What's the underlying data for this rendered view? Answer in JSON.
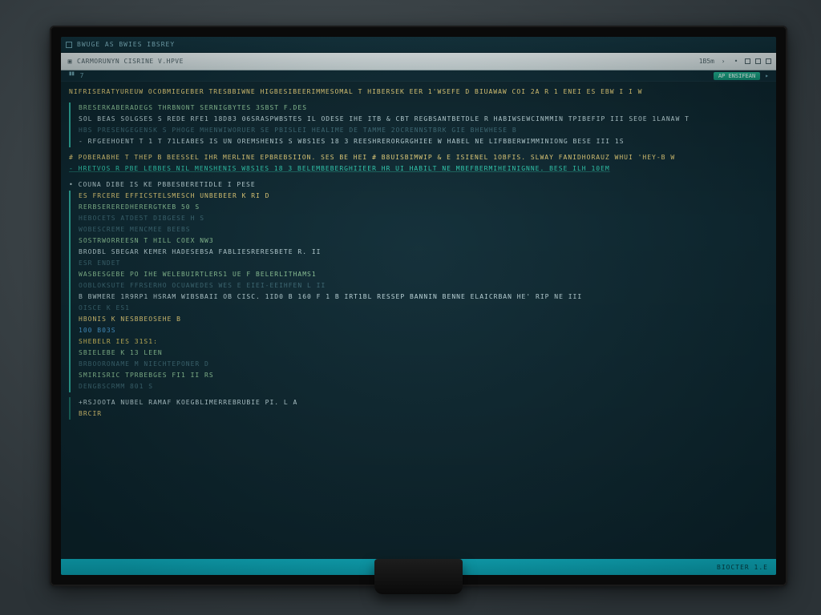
{
  "window": {
    "title": "BWUGE AS  BWIES  IBSREY"
  },
  "toolbar": {
    "address": "CARMORUNYN CISRINE V.HPVE",
    "right_label": "1B5m",
    "right_chevron": "›"
  },
  "prompt": {
    "left_symbol": "▝▘",
    "left_num": "7",
    "badge": "AP ENSIFEAN",
    "chevron": "▸"
  },
  "terminal": {
    "header": "NIFRISERATYUREUW  OCOBMIEGEBER TRESBBIWNE  HIGBESIBEERIMMESOMAL T  HIBERSEK EER  1'WSEFE D  BIUAWAW COI 2A R  1 ENEI ES  EBW I I W",
    "block_a": [
      "BRESERKABERADEGS THRBNONT  SERNIGBYTES 3SBST F.DES",
      "SOL BEAS  SOLGSES S REDE  RFE1  18D83 06SRASPWBSTES  IL ODESE  IHE ITB  & CBT  REGBSANTBETDLE R   HABIWSEWCINMMIN TPIBEFIP III SEOE  1LANAW T",
      "HBS   PRESENGEGENSK S PHOGE MHENWIWORUER SE   PBISLEI  HEALIME     DE TAMME 2OCRENNSTBRK GIE  BHEWHESE B",
      "- RFGEEHOENT T 1 T 71LEABES IS   UN OREMSHENIS S  W8S1ES  18   3     REESHRERORGRGHIEE  W  HABEL NE  LIFBBERWIMMINIONG  BESE III 1S"
    ],
    "block_b": [
      "# POBERABHE T THEP B  BEESSEL  IHR MERLINE EPBREBSIION. SES BE HEI  # B8UISBIMWIP & E   ISIENEL 1OBFIS. SLWAY FANIDHORAUZ   WHUI  'HEY-B W",
      " - HRETVOS R   PBE  LEBBES  NIL   MENSHENIS  W8S1ES   18   3       BELEMBEBERGHIIEER HR UI HABILT NE  MBEFBERMIHEINIGNNE. BESE ILH 10EM"
    ],
    "block_c_header": "• COUNA DIBE IS KE PBBESBERETIDLE I PESE",
    "block_c": [
      "ES  FRCERE   EFFICSTELSMESCH  UNBEBEER K  RI D",
      "RERBSEREREDHERERGTKEB 50 S",
      "HEBOCETS  ATDE5T DIBGESE  H S",
      "WOBESCREME MENCMEE BEEBS",
      "SOSTRWORREESN T HILL COEX NW3",
      "BRODBL SBEGAR  KEMER  HADESEBSA  FABLIESRERESBETE R. II",
      "ESR  ENDET",
      "WASBESGEBE PO  IHE WELEBUIRTLERS1 UE F BELERLITHAMS1",
      "OOBLOKSUTE FFRSERHO  OCUAWEDES   WES E  EIEI-EEIHFEN L  II",
      "B BWMERE  1R9RP1  HSRAM WIBSBAII  OB CISC.  1ID0 B  160 F 1 B IRT1BL RESSEP  BANNIN  BENNE ELAICRBAN HE' RIP NE III",
      "OISCE K ES1",
      "HBONIS K NESBBEOSEHE  B",
      "100  B03S",
      "SHEBELR IES   31S1:",
      "SBIELEBE K 13 LEEN",
      "BRBOORONAME M NIECHTEPONER  D",
      "SMIRISRIC TPRBEBGES FI1 II RS",
      "DENGBSCRMM 801 S"
    ],
    "footer": [
      "+RSJOOTA NUBEL RAMAF KOEGBLIMERREBRUBIE PI. L   A",
      "BRCIR"
    ]
  },
  "statusbar": {
    "left": "",
    "right": "BIOCTER 1.E"
  },
  "colors": {
    "bg": "#0e2b35",
    "accent_cyan": "#0fb7c9",
    "accent_green": "#2fb0a0",
    "yellow": "#e8d27a",
    "green_text": "#8ec89a"
  }
}
